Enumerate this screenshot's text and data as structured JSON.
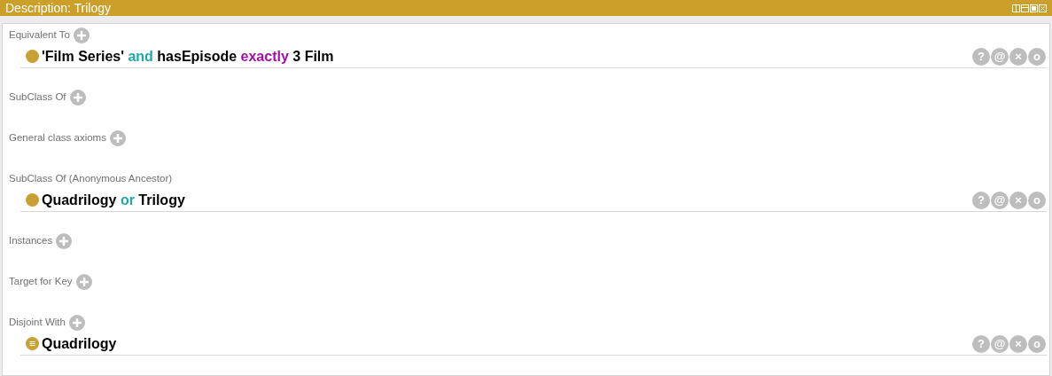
{
  "window": {
    "title": "Description: Trilogy"
  },
  "sections": [
    {
      "label": "Equivalent To",
      "addable": true,
      "entries": [
        {
          "kind": "class",
          "tokens": [
            {
              "text": "'Film Series'",
              "kind": "entity"
            },
            {
              "text": "and",
              "kind": "connective"
            },
            {
              "text": "hasEpisode",
              "kind": "entity"
            },
            {
              "text": "exactly",
              "kind": "restriction"
            },
            {
              "text": "3 Film",
              "kind": "entity"
            }
          ],
          "actions": [
            "?",
            "@",
            "×",
            "o"
          ]
        }
      ]
    },
    {
      "label": "SubClass Of",
      "addable": true
    },
    {
      "label": "General class axioms",
      "addable": true
    },
    {
      "label": "SubClass Of (Anonymous Ancestor)",
      "addable": false,
      "entries": [
        {
          "kind": "class",
          "tokens": [
            {
              "text": "Quadrilogy",
              "kind": "entity"
            },
            {
              "text": "or",
              "kind": "connective"
            },
            {
              "text": "Trilogy",
              "kind": "entity"
            }
          ],
          "actions": [
            "?",
            "@",
            "×",
            "o"
          ]
        }
      ]
    },
    {
      "label": "Instances",
      "addable": true
    },
    {
      "label": "Target for Key",
      "addable": true
    },
    {
      "label": "Disjoint With",
      "addable": true,
      "entries": [
        {
          "kind": "disjoint",
          "tokens": [
            {
              "text": "Quadrilogy",
              "kind": "entity"
            }
          ],
          "actions": [
            "?",
            "@",
            "×",
            "o"
          ]
        }
      ]
    }
  ]
}
